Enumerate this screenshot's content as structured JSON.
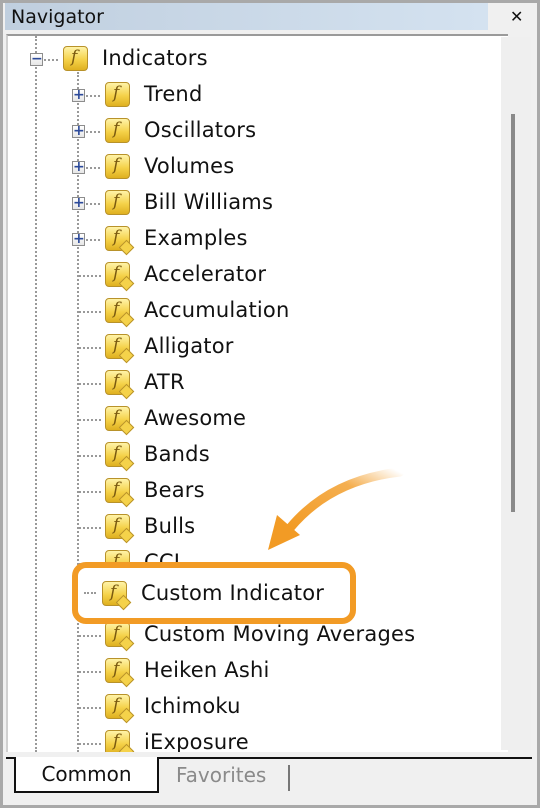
{
  "window": {
    "title": "Navigator",
    "close_icon": "close-icon"
  },
  "tree": {
    "root": {
      "label": "Indicators",
      "expanded": true,
      "icon": "function-icon"
    },
    "groups": [
      {
        "label": "Trend",
        "icon": "function-icon"
      },
      {
        "label": "Oscillators",
        "icon": "function-icon"
      },
      {
        "label": "Volumes",
        "icon": "function-icon"
      },
      {
        "label": "Bill Williams",
        "icon": "function-icon"
      },
      {
        "label": "Examples",
        "icon": "custom-function-icon"
      }
    ],
    "items": [
      {
        "label": "Accelerator"
      },
      {
        "label": "Accumulation"
      },
      {
        "label": "Alligator"
      },
      {
        "label": "ATR"
      },
      {
        "label": "Awesome"
      },
      {
        "label": "Bands"
      },
      {
        "label": "Bears"
      },
      {
        "label": "Bulls"
      },
      {
        "label": "CCI"
      },
      {
        "label": "Custom Indicator"
      },
      {
        "label": "Custom Moving Averages"
      },
      {
        "label": "Heiken Ashi"
      },
      {
        "label": "Ichimoku"
      },
      {
        "label": "iExposure"
      }
    ]
  },
  "annotation": {
    "highlighted_item": "Custom Indicator",
    "color": "#f29b25"
  },
  "tabs": [
    {
      "label": "Common",
      "active": true
    },
    {
      "label": "Favorites",
      "active": false
    }
  ]
}
